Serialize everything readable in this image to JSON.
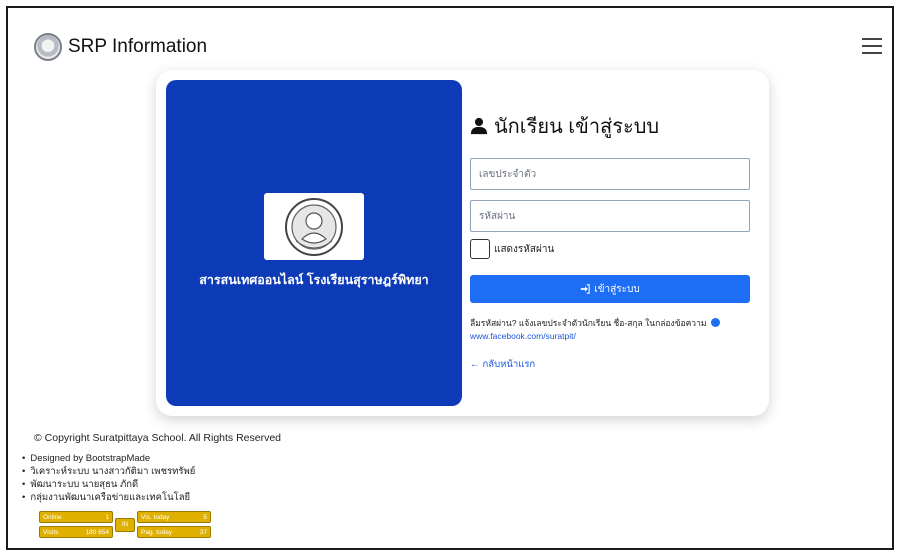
{
  "header": {
    "brand": "SRP Information",
    "menu_icon": "hamburger-menu-icon"
  },
  "card": {
    "left": {
      "caption": "สารสนเทศออนไลน์ โรงเรียนสุราษฎร์พิทยา",
      "seal_icon": "school-seal-logo"
    },
    "right": {
      "title": "นักเรียน เข้าสู่ระบบ",
      "title_icon": "user-icon",
      "id_placeholder": "เลขประจำตัว",
      "password_placeholder": "รหัสผ่าน",
      "show_password_label": "แสดงรหัสผ่าน",
      "login_label": "เข้าสู่ระบบ",
      "forgot_text": "ลืมรหัสผ่าน? แจ้งเลขประจำตัวนักเรียน ชื่อ-สกุล ในกล่องข้อความ",
      "facebook_link": "www.facebook.com/suratpit/",
      "back_label": "กลับหน้าแรก"
    }
  },
  "footer": {
    "copyright": "© Copyright Suratpittaya School. All Rights Reserved",
    "credits": [
      "Designed by BootstrapMade",
      "วิเคราะห์ระบบ นางสาวกัติมา เพชรทรัพย์",
      "พัฒนาระบบ นายสุธน ภักดี",
      "กลุ่มงานพัฒนาเครือข่ายและเทคโนโลยี"
    ],
    "counter": {
      "online_label": "Online",
      "online_value": "1",
      "visits_label": "Visits",
      "visits_value": "180 654",
      "vis_today_label": "Vis. today",
      "vis_today_value": "5",
      "pag_today_label": "Pag. today",
      "pag_today_value": "37",
      "mid_label": "IN"
    }
  },
  "colors": {
    "panel_blue": "#0d3bb8",
    "button_blue": "#1e6ef5",
    "link_blue": "#1a56db",
    "counter_gold": "#e0b000"
  }
}
